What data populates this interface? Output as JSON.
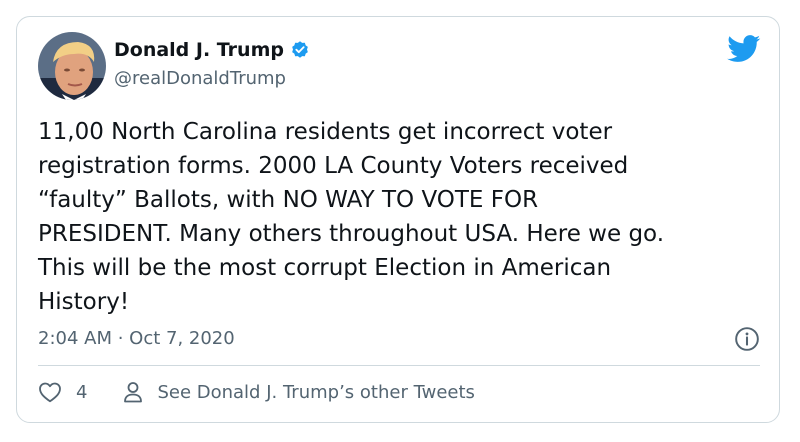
{
  "author": {
    "name": "Donald J. Trump",
    "handle": "@realDonaldTrump",
    "verified": true
  },
  "tweet": {
    "text": "11,00 North Carolina residents get incorrect voter\nregistration forms. 2000 LA County Voters received\n“faulty” Ballots, with NO WAY TO VOTE FOR\nPRESIDENT. Many others throughout USA. Here we go.\nThis will be the most corrupt Election in American\nHistory!",
    "timestamp": "2:04 AM · Oct 7, 2020"
  },
  "actions": {
    "like_count": "4",
    "other_tweets_label": "See Donald J. Trump’s other Tweets"
  },
  "colors": {
    "text": "#0f1419",
    "secondary": "#536471",
    "brand": "#1d9bf0",
    "border": "#cfd9de"
  },
  "icons": {
    "avatar": "avatar",
    "verified": "verified-badge-icon",
    "brand": "twitter-bird-icon",
    "info": "info-icon",
    "like": "heart-icon",
    "profile": "person-icon"
  }
}
